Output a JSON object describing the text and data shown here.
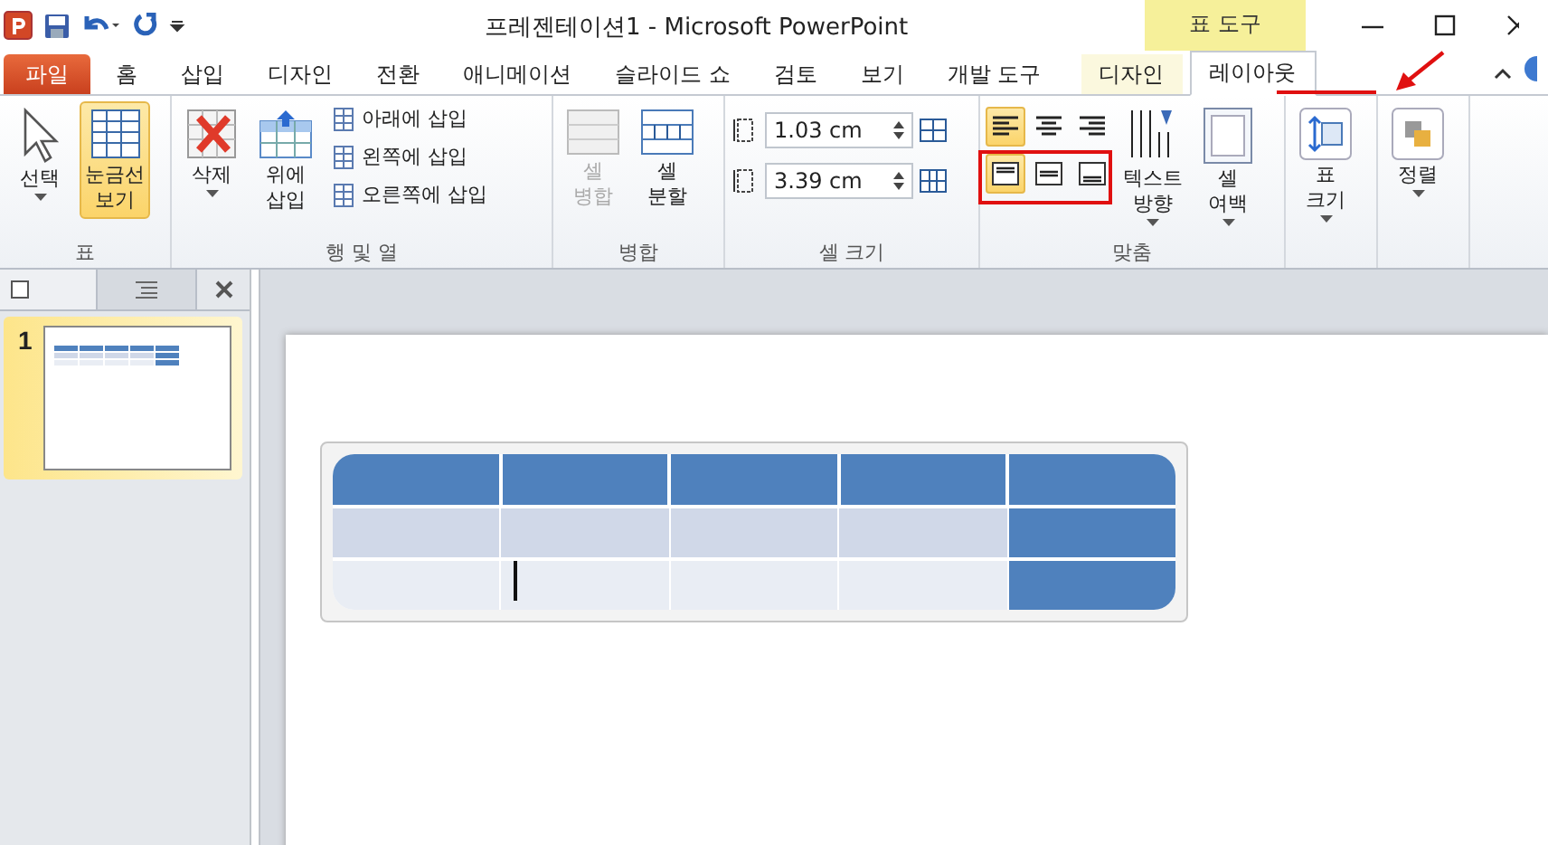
{
  "window": {
    "title": "프레젠테이션1 - Microsoft PowerPoint"
  },
  "contextual_group": {
    "label": "표 도구"
  },
  "tabs": [
    {
      "label": "파일",
      "kind": "file",
      "selected": false
    },
    {
      "label": "홈",
      "kind": "normal",
      "selected": false
    },
    {
      "label": "삽입",
      "kind": "normal",
      "selected": false
    },
    {
      "label": "디자인",
      "kind": "normal",
      "selected": false
    },
    {
      "label": "전환",
      "kind": "normal",
      "selected": false
    },
    {
      "label": "애니메이션",
      "kind": "normal",
      "selected": false
    },
    {
      "label": "슬라이드 쇼",
      "kind": "normal",
      "selected": false
    },
    {
      "label": "검토",
      "kind": "normal",
      "selected": false
    },
    {
      "label": "보기",
      "kind": "normal",
      "selected": false
    },
    {
      "label": "개발 도구",
      "kind": "normal",
      "selected": false
    },
    {
      "label": "디자인",
      "kind": "contextual",
      "selected": false
    },
    {
      "label": "레이아웃",
      "kind": "contextual",
      "selected": true
    }
  ],
  "ribbon": {
    "groups": [
      {
        "label": "표",
        "buttons": [
          {
            "label": "선택",
            "selected": false
          },
          {
            "label": "눈금선\n보기",
            "selected": true
          }
        ]
      },
      {
        "label": "행 및 열",
        "buttons": [
          {
            "label": "삭제"
          },
          {
            "label": "위에\n삽입"
          },
          {
            "label": "아래에 삽입"
          },
          {
            "label": "왼쪽에 삽입"
          },
          {
            "label": "오른쪽에 삽입"
          }
        ]
      },
      {
        "label": "병합",
        "buttons": [
          {
            "label": "셀\n병합",
            "disabled": true
          },
          {
            "label": "셀\n분할",
            "disabled": false
          }
        ]
      },
      {
        "label": "셀 크기",
        "fields": [
          {
            "value": "1.03 cm"
          },
          {
            "value": "3.39 cm"
          }
        ]
      },
      {
        "label": "맞춤",
        "align_buttons": [
          {
            "selected": true
          },
          {
            "selected": false
          },
          {
            "selected": false
          },
          {
            "selected": true
          },
          {
            "selected": false
          },
          {
            "selected": false
          }
        ],
        "buttons": [
          {
            "label": "텍스트\n방향"
          },
          {
            "label": "셀\n여백"
          }
        ]
      },
      {
        "buttons": [
          {
            "label": "표\n크기"
          }
        ]
      },
      {
        "buttons": [
          {
            "label": "정렬"
          }
        ]
      }
    ]
  },
  "slides_pane": {
    "slides": [
      {
        "number": "1",
        "selected": true
      }
    ]
  },
  "table": {
    "rows": [
      {
        "cells": [
          {
            "color": "#4f81bd"
          },
          {
            "color": "#4f81bd"
          },
          {
            "color": "#4f81bd"
          },
          {
            "color": "#4f81bd"
          },
          {
            "color": "#4f81bd"
          }
        ]
      },
      {
        "cells": [
          {
            "color": "#d0d8e8"
          },
          {
            "color": "#d0d8e8"
          },
          {
            "color": "#d0d8e8"
          },
          {
            "color": "#d0d8e8"
          },
          {
            "color": "#4f81bd"
          }
        ]
      },
      {
        "cells": [
          {
            "color": "#e9edf4"
          },
          {
            "color": "#e9edf4"
          },
          {
            "color": "#e9edf4"
          },
          {
            "color": "#e9edf4"
          },
          {
            "color": "#4f81bd"
          }
        ]
      }
    ]
  }
}
